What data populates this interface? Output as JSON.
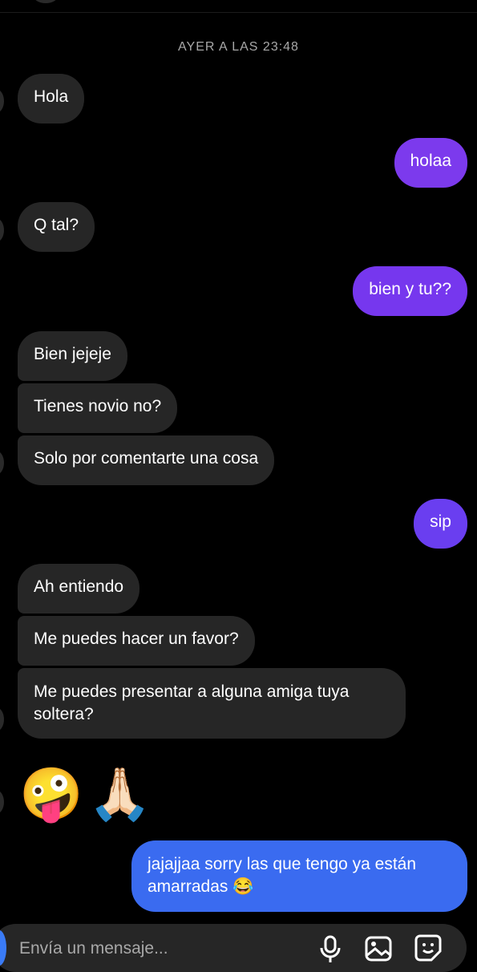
{
  "colors": {
    "background": "#000000",
    "incoming_bubble": "#262626",
    "outgoing_purple": "#7c3aed",
    "outgoing_violet": "#6a3ef0",
    "outgoing_blue": "#3a6bf0",
    "muted_text": "#a8a8a8"
  },
  "thread": {
    "timestamp": "AYER A LAS 23:48",
    "messages": [
      {
        "from": "them",
        "text": "Hola"
      },
      {
        "from": "me",
        "text": "holaa"
      },
      {
        "from": "them",
        "text": "Q tal?"
      },
      {
        "from": "me",
        "text": "bien y tu??"
      },
      {
        "from": "them",
        "text": "Bien jejeje"
      },
      {
        "from": "them",
        "text": "Tienes novio no?"
      },
      {
        "from": "them",
        "text": "Solo por comentarte una cosa"
      },
      {
        "from": "me",
        "text": "sip"
      },
      {
        "from": "them",
        "text": "Ah entiendo"
      },
      {
        "from": "them",
        "text": "Me puedes hacer un favor?"
      },
      {
        "from": "them",
        "text_line1": "Me puedes presentar a alguna amiga tuya",
        "text_line2": "soltera?"
      },
      {
        "from": "them",
        "emoji1": "🤪",
        "emoji2": "🙏🏻"
      },
      {
        "from": "me",
        "text_line1": "jajajjaa sorry las que tengo ya están",
        "text_line2": "amarradas 😂"
      }
    ]
  },
  "composer": {
    "placeholder": "Envía un mensaje...",
    "icons": [
      "microphone-icon",
      "photo-icon",
      "sticker-icon"
    ]
  }
}
